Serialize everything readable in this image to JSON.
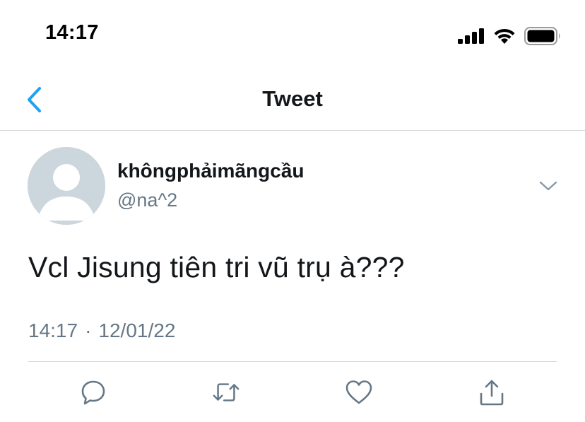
{
  "status_bar": {
    "time": "14:17",
    "icons": [
      "signal-icon",
      "wifi-icon",
      "battery-icon"
    ]
  },
  "nav": {
    "back_icon": "chevron-left-icon",
    "title": "Tweet"
  },
  "tweet": {
    "display_name": "khôngphảimãngcầu",
    "handle": "@na^2",
    "text": "Vcl Jisung tiên tri vũ trụ à???",
    "time": "14:17",
    "separator": "·",
    "date": "12/01/22"
  },
  "actions": [
    "reply-icon",
    "retweet-icon",
    "like-icon",
    "share-icon"
  ],
  "colors": {
    "accent": "#1da1f2",
    "secondary_text": "#657786",
    "icon_gray": "#657786",
    "divider": "#d6d9db",
    "avatar_bg": "#ccd6dd"
  }
}
